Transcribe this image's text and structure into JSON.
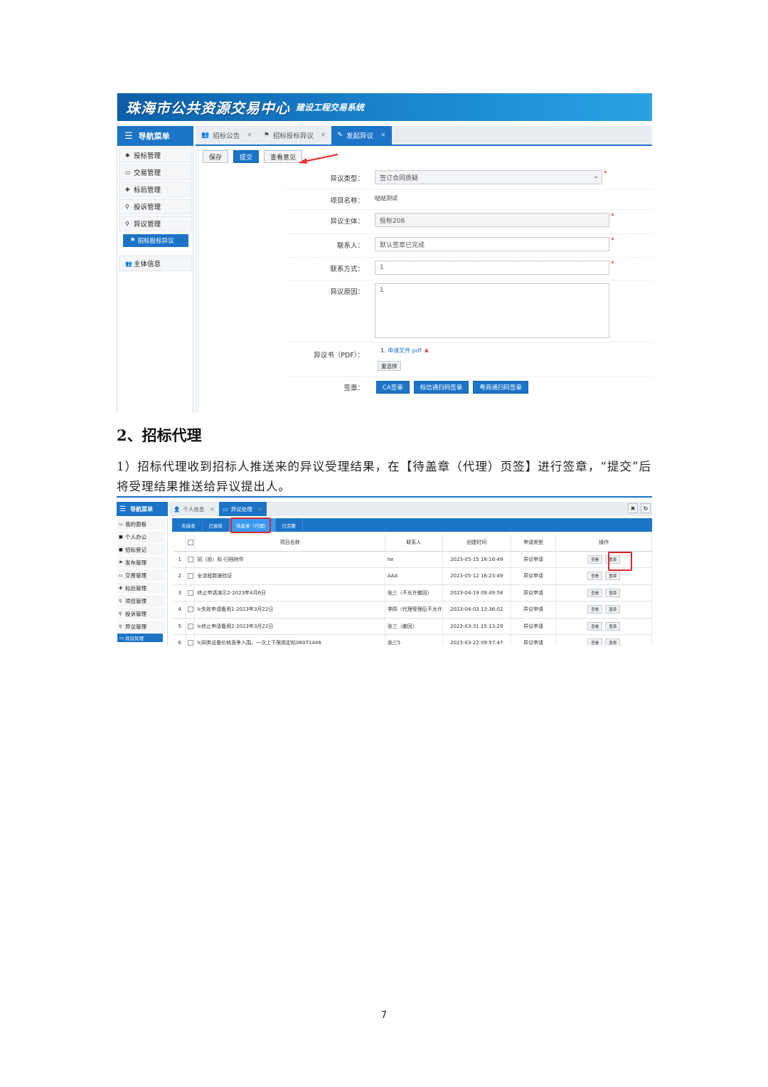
{
  "shot1": {
    "banner_title": "珠海市公共资源交易中心",
    "banner_sub": "建设工程交易系统",
    "nav_title": "导航菜单",
    "sidebar": [
      {
        "icon": "asterisk-icon",
        "glyph": "✱",
        "label": "投标管理"
      },
      {
        "icon": "monitor-icon",
        "glyph": "▭",
        "label": "交易管理"
      },
      {
        "icon": "pin-icon",
        "glyph": "✚",
        "label": "标后管理"
      },
      {
        "icon": "link-icon",
        "glyph": "⚲",
        "label": "投诉管理"
      },
      {
        "icon": "link-icon",
        "glyph": "⚲",
        "label": "异议管理"
      }
    ],
    "sidebar_sub": "招标投标异议",
    "sidebar_extra": "主体信息",
    "tabs": [
      {
        "label": "招标公告"
      },
      {
        "label": "招标投标异议"
      },
      {
        "label": "发起异议"
      }
    ],
    "toolbar": {
      "save": "保存",
      "submit": "提交",
      "view": "查看意见"
    },
    "form": {
      "type_label": "异议类型：",
      "type_value": "签订合同质疑",
      "project_label": "项目名称：",
      "project_value": "哒哒测试",
      "subject_label": "异议主体：",
      "subject_value": "投标208",
      "contact_label": "联系人：",
      "contact_value": "默认签章已完成",
      "phone_label": "联系方式：",
      "phone_value": "1",
      "reason_label": "异议原因：",
      "reason_value": "1",
      "pdf_label": "异议书（PDF）：",
      "pdf_index": "1.",
      "pdf_file": "申请文件.pdf",
      "pdf_remove": "x",
      "pdf_reselect": "重选择",
      "sign_label": "签章：",
      "sign_ca": "CA签章",
      "sign_scan1": "标信通扫码签章",
      "sign_scan2": "粤商通扫码签章"
    }
  },
  "section": {
    "heading": "2、招标代理",
    "paragraph": "1）招标代理收到招标人推送来的异议受理结果，在【待盖章（代理）页签】进行签章，“提交”后将受理结果推送给异议提出人。"
  },
  "shot2": {
    "nav_title": "导航菜单",
    "sidebar": [
      {
        "glyph": "▭",
        "label": "我的面板"
      },
      {
        "glyph": "■",
        "label": "个人办公"
      },
      {
        "glyph": "■",
        "label": "招标登记"
      },
      {
        "glyph": "⚑",
        "label": "发布管理"
      },
      {
        "glyph": "▭",
        "label": "交易管理"
      },
      {
        "glyph": "✚",
        "label": "标后管理"
      },
      {
        "glyph": "⚲",
        "label": "项目管理"
      },
      {
        "glyph": "⚲",
        "label": "投诉管理"
      },
      {
        "glyph": "⚲",
        "label": "异议管理"
      }
    ],
    "sidebar_sub": "异议处理",
    "tabs": [
      {
        "label": "个人信息"
      },
      {
        "label": "异议处理"
      }
    ],
    "win_close": "✖",
    "win_refresh": "↻",
    "subtabs": [
      "未接收",
      "已接收",
      "待盖章（代理）",
      "已完整"
    ],
    "columns": [
      "",
      "项目名称",
      "联系人",
      "创建时间",
      "申请类型",
      "操作"
    ],
    "view_label": "查看",
    "seal_label": "盖章",
    "rows": [
      {
        "no": "1",
        "name": "招（投）标-归档附件",
        "contact": "he",
        "time": "2023-05-15 16:16:49",
        "type": "异议申请"
      },
      {
        "no": "2",
        "name": "全流程数据验证",
        "contact": "AAA",
        "time": "2023-05-12 16:23:49",
        "type": "异议申请"
      },
      {
        "no": "3",
        "name": "终止申请演示2-2023年4月6日",
        "contact": "张三（不允许撤回）",
        "time": "2023-04-19 09:49:58",
        "type": "异议申请"
      },
      {
        "no": "4",
        "name": "lc失败申请备用1-2023年3月22日",
        "contact": "李四（代理受理后不允许",
        "time": "2023-04-03 13:36:02",
        "type": "异议申请"
      },
      {
        "no": "5",
        "name": "lc终止申请备用2-2023年3月22日",
        "contact": "张三（撤回）",
        "time": "2023-03-31 15:13:29",
        "type": "异议申请"
      },
      {
        "no": "6",
        "name": "lc同类设备价格竞争入围，一次上下限用定标06071446",
        "contact": "张三5",
        "time": "2023-03-22 09:57:47",
        "type": "异议申请"
      }
    ]
  },
  "page_number": "7",
  "colors": {
    "brand_blue": "#1c74c7",
    "highlight_red": "#e0262b",
    "arrow_red": "#e53935"
  }
}
